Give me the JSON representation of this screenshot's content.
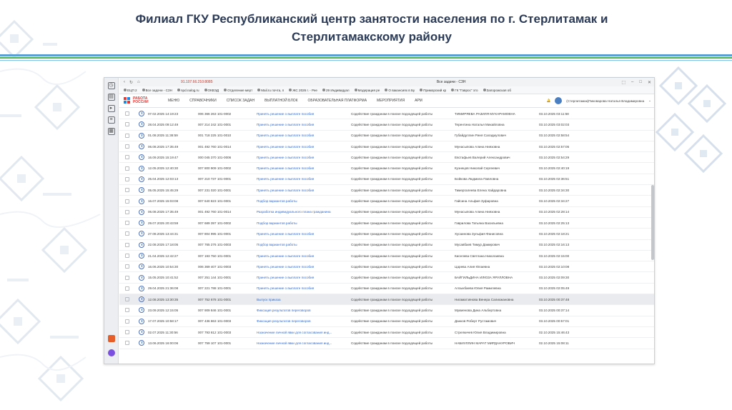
{
  "slide": {
    "title_line1": "Филиал ГКУ Республиканский центр занятости населения по г. Стерлитамак и",
    "title_line2": "Стерлитамакскому району"
  },
  "browser": {
    "url": "91.107.66.210:8085",
    "tab_title": "Все задачи - СЗН",
    "bookmarks": [
      "ЕЦП 2",
      "Все задачи - СЗН",
      "npd.nalog.ru",
      "ОКВЭД",
      "Отделение мерт",
      "Mail.ru почта, п",
      "ЖС 2026 г. - Рее",
      "29 Индивидуал",
      "Модерация ре",
      "О вакансиях в Бу",
      "Приморский кр",
      "ГК \"Гаврос\" зто",
      "Запорожская об"
    ]
  },
  "app": {
    "logo_line1": "РАБОТА",
    "logo_line2": "РОССИИ",
    "menu": [
      "МЕНЮ",
      "СПРАВОЧНИКИ",
      "СПИСОК ЗАДАН",
      "ВЫПЛАТНОЙ БЛОК",
      "ОБРАЗОВАТЕЛЬНАЯ ПЛАТФОРМА",
      "МЕРОПРИЯТИЯ",
      "АРМ"
    ],
    "user": "(Стерлитамак)Пиковарова Наталья Владимировна"
  },
  "tasks": [
    {
      "date": "07.02.2025 14:19:23",
      "num": "006 366 263 101-0002",
      "action": "Принять решение о выплате пособия",
      "service": "Содействие гражданам в поиске подходящей работы",
      "name": "ТИМИРЯЕВА РАЗИЛЯ МУХАРАМОВНА",
      "time": "03.10.2025 03:11:58",
      "hl": false
    },
    {
      "date": "28.04.2025 09:12:49",
      "num": "007 214 242 101-0001",
      "action": "Принять решение о выплате пособия",
      "service": "Содействие гражданам в поиске подходящей работы",
      "name": "Терентина Наталья Михайловна",
      "time": "03.10.2025 03:02:03",
      "hl": false
    },
    {
      "date": "01.08.2025 11:38:59",
      "num": "001 718 225 101-0010",
      "action": "Принять решение о выплате пособия",
      "service": "Содействие гражданам в поиске подходящей работы",
      "name": "Губайдуллин Риня Саладиулович",
      "time": "03.10.2025 02:58:54",
      "hl": false
    },
    {
      "date": "06.08.2025 17:35:49",
      "num": "001 492 760 101-0014",
      "action": "Принять решение о выплате пособия",
      "service": "Содействие гражданам в поиске подходящей работы",
      "name": "Мунасыпова Алина Ниязовна",
      "time": "03.10.2025 02:57:05",
      "hl": false
    },
    {
      "date": "16.09.2025 15:19:47",
      "num": "000 045 370 101-0006",
      "action": "Принять решение о выплате пособия",
      "service": "Содействие гражданам в поиске подходящей работы",
      "name": "Евстафьев Валерий Александрович",
      "time": "03.10.2025 02:54:29",
      "hl": false
    },
    {
      "date": "12.05.2025 12:40:30",
      "num": "007 800 909 101-0002",
      "action": "Принять решение о выплате пособия",
      "service": "Содействие гражданам в поиске подходящей работы",
      "name": "Кузнецов Николай Сергеевич",
      "time": "03.10.2025 02:40:19",
      "hl": false
    },
    {
      "date": "25.04.2025 12:03:13",
      "num": "007 210 737 101-0001",
      "action": "Принять решение о выплате пособия",
      "service": "Содействие гражданам в поиске подходящей работы",
      "name": "Бойкова Людмила Павловна",
      "time": "03.10.2025 02:36:51",
      "hl": false
    },
    {
      "date": "05.05.2025 15:45:29",
      "num": "007 231 020 101-0001",
      "action": "Принять решение о выплате пособия",
      "service": "Содействие гражданам в поиске подходящей работы",
      "name": "Тимергалеева Елена Хайдаровна",
      "time": "03.10.2025 02:34:30",
      "hl": false
    },
    {
      "date": "16.07.2025 15:03:08",
      "num": "007 640 823 101-0001",
      "action": "Подбор вариантов работы",
      "service": "Содействие гражданам в поиске подходящей работы",
      "name": "Гайсина Альфия Зуфаровна",
      "time": "03.10.2025 02:34:27",
      "hl": false
    },
    {
      "date": "06.08.2025 17:35:49",
      "num": "001 492 760 101-0014",
      "action": "Разработка индивидуального плана гражданина",
      "service": "Содействие гражданам в поиске подходящей работы",
      "name": "Мунасыпова Алина Ниязовна",
      "time": "03.10.2025 02:28:14",
      "hl": false
    },
    {
      "date": "29.07.2025 20:43:59",
      "num": "007 689 397 101-0002",
      "action": "Подбор вариантов работы",
      "service": "Содействие гражданам в поиске подходящей работы",
      "name": "Гаврилова Татьяна Васильевна",
      "time": "03.10.2025 02:25:13",
      "hl": false
    },
    {
      "date": "27.08.2025 13:44:31",
      "num": "007 804 995 101-0001",
      "action": "Принять решение о выплате пособия",
      "service": "Содействие гражданам в поиске подходящей работы",
      "name": "Хусаинова Зульфия Фанисовна",
      "time": "03.10.2025 02:18:21",
      "hl": false
    },
    {
      "date": "22.08.2025 17:18:05",
      "num": "007 765 276 101-0003",
      "action": "Подбор вариантов работы",
      "service": "Содействие гражданам в поиске подходящей работы",
      "name": "Мусавбаев Тимур Дамирович",
      "time": "03.10.2025 02:16:13",
      "hl": false
    },
    {
      "date": "21.04.2025 12:42:27",
      "num": "007 193 750 101-0001",
      "action": "Принять решение о выплате пособия",
      "service": "Содействие гражданам в поиске подходящей работы",
      "name": "Киселева Светлана Николаевна",
      "time": "03.10.2025 02:15:00",
      "hl": false
    },
    {
      "date": "16.06.2025 10:54:30",
      "num": "006 369 407 101-0003",
      "action": "Принять решение о выплате пособия",
      "service": "Содействие гражданам в поиске подходящей работы",
      "name": "Царева Алия Юлаевна",
      "time": "03.10.2025 02:10:08",
      "hl": false
    },
    {
      "date": "15.05.2025 10:41:52",
      "num": "007 251 144 101-0001",
      "action": "Принять решение о выплате пособия",
      "service": "Содействие гражданам в поиске подходящей работы",
      "name": "БАЙГИЛЬДИНА ИЛЮЗА ЯРУЛЛОВНА",
      "time": "03.10.2025 02:09:30",
      "hl": false
    },
    {
      "date": "29.04.2025 21:36:08",
      "num": "007 221 788 101-0001",
      "action": "Принять решение о выплате пособия",
      "service": "Содействие гражданам в поиске подходящей работы",
      "name": "Алсыкбаева Юлия Рамилевна",
      "time": "03.10.2025 02:05:49",
      "hl": false
    },
    {
      "date": "12.08.2025 13:30:35",
      "num": "007 752 678 101-0001",
      "action": "Выпуск приказа",
      "service": "Содействие гражданам в поиске подходящей работы",
      "name": "Нигаматзянова Венера Салихжановна",
      "time": "03.10.2025 00:37:48",
      "hl": true
    },
    {
      "date": "23.09.2025 12:15:05",
      "num": "007 909 846 101-0001",
      "action": "Фиксация результатов переговоров",
      "service": "Содействие гражданам в поиске подходящей работы",
      "name": "Мукменова Дина Альбертовна",
      "time": "03.10.2025 00:37:14",
      "hl": false
    },
    {
      "date": "17.07.2025 10:58:17",
      "num": "007 436 863 101-0003",
      "action": "Фиксация результатов переговоров",
      "service": "Содействие гражданам в поиске подходящей работы",
      "name": "Данков Роберт Рустамович",
      "time": "03.10.2025 00:57:01",
      "hl": false
    },
    {
      "date": "02.07.2025 11:30:56",
      "num": "007 793 812 101-0003",
      "action": "Назначение личной явки для согласования инд...",
      "service": "Содействие гражданам в поиске подходящей работы",
      "name": "Стрелкичев Юлия Владимировна",
      "time": "02.10.2025 15:46:43",
      "hl": false
    },
    {
      "date": "13.06.2025 16:00:06",
      "num": "007 759 107 101-0001",
      "action": "Назначение личной явки для согласования инд...",
      "service": "Содействие гражданам в поиске подходящей работы",
      "name": "НАБИУЛЛИН МАРАТ МИРДАНУРОВИЧ",
      "time": "02.10.2025 15:08:11",
      "hl": false
    }
  ]
}
